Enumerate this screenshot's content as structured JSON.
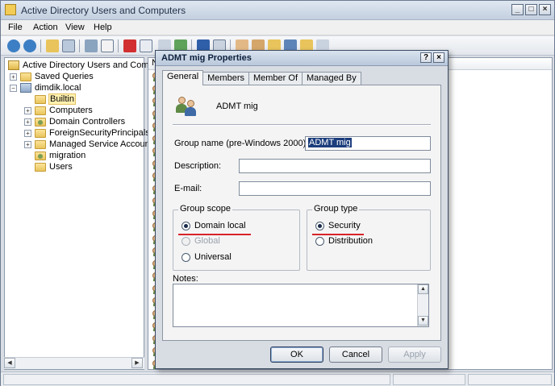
{
  "main_window": {
    "title": "Active Directory Users and Computers"
  },
  "menu": [
    "File",
    "Action",
    "View",
    "Help"
  ],
  "tree": {
    "items": [
      {
        "label": "Active Directory Users and Comput",
        "level": 0
      },
      {
        "label": "Saved Queries",
        "level": 1
      },
      {
        "label": "dimdik.local",
        "level": 1
      },
      {
        "label": "Builtin",
        "level": 2
      },
      {
        "label": "Computers",
        "level": 2
      },
      {
        "label": "Domain Controllers",
        "level": 2
      },
      {
        "label": "ForeignSecurityPrincipals",
        "level": 2
      },
      {
        "label": "Managed Service Accounts",
        "level": 2
      },
      {
        "label": "migration",
        "level": 2
      },
      {
        "label": "Users",
        "level": 2
      }
    ]
  },
  "list": {
    "header": "N"
  },
  "dialog": {
    "title": "ADMT mig Properties",
    "help_glyph": "?",
    "close_glyph": "×",
    "tabs": [
      "General",
      "Members",
      "Member Of",
      "Managed By"
    ],
    "group_name": "ADMT mig",
    "fields": {
      "pre2000_label": "Group name (pre-Windows 2000):",
      "pre2000_value": "ADMT mig",
      "description_label": "Description:",
      "description_value": "",
      "email_label": "E-mail:",
      "email_value": ""
    },
    "group_scope": {
      "title": "Group scope",
      "options": [
        "Domain local",
        "Global",
        "Universal"
      ],
      "selected": "Domain local"
    },
    "group_type": {
      "title": "Group type",
      "options": [
        "Security",
        "Distribution"
      ],
      "selected": "Security"
    },
    "notes_label": "Notes:",
    "notes_value": "",
    "buttons": {
      "ok": "OK",
      "cancel": "Cancel",
      "apply": "Apply"
    },
    "highlight_color": "#d8232a"
  }
}
